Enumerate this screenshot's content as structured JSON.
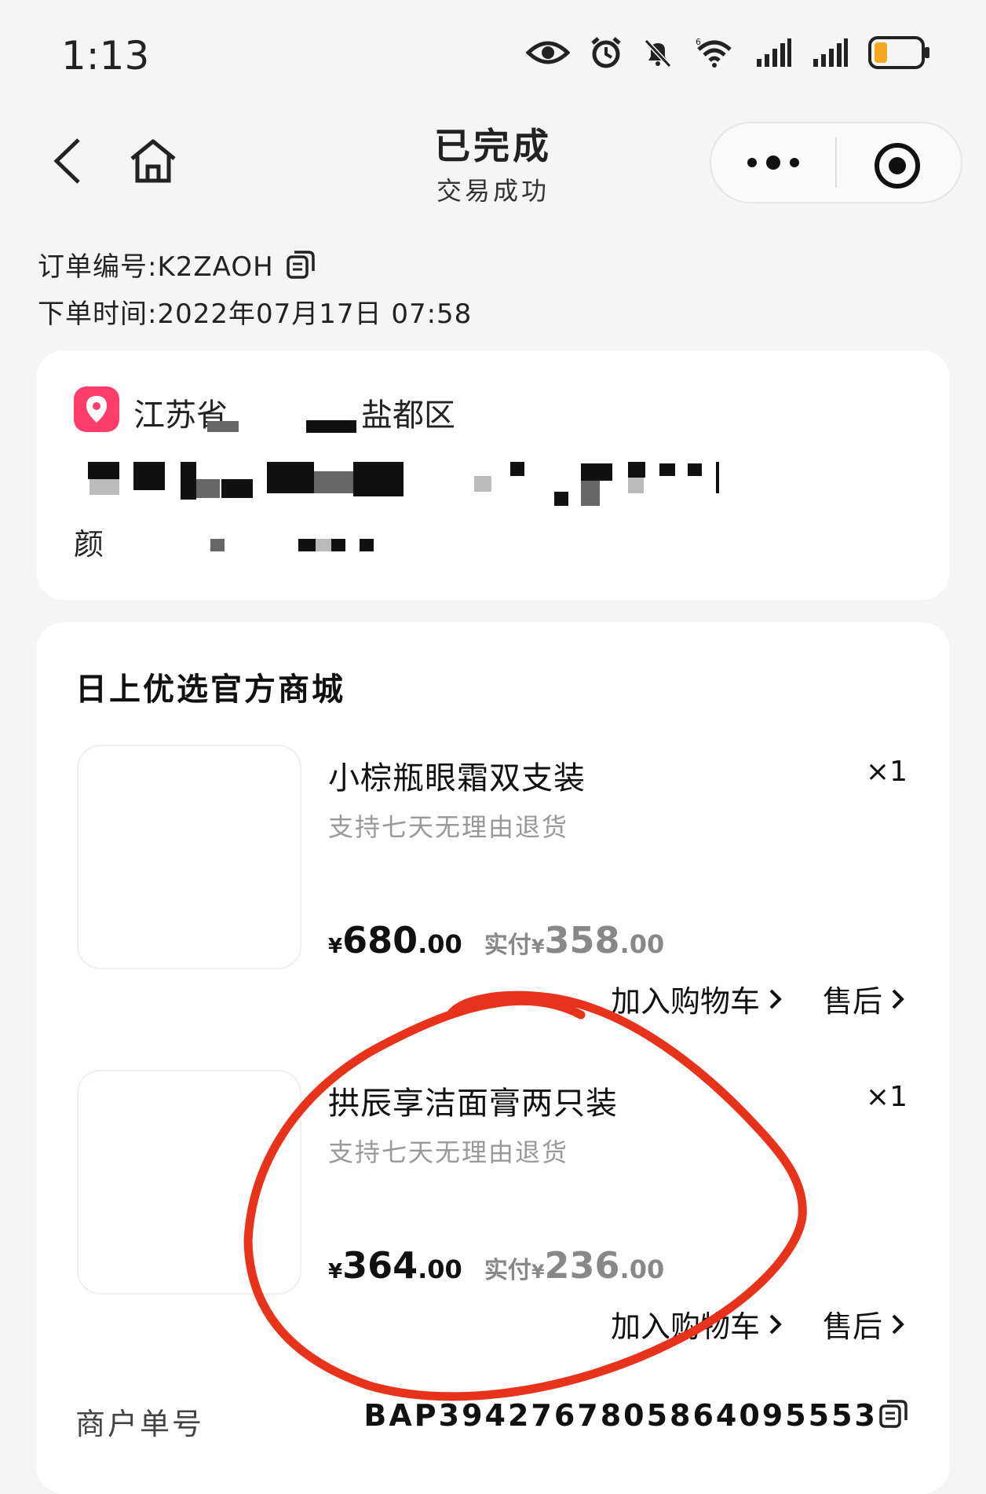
{
  "status_bar": {
    "time": "1:13",
    "wifi_badge": "6"
  },
  "header": {
    "title": "已完成",
    "subtitle": "交易成功"
  },
  "order": {
    "number_line": "订单编号:K2ZAOH",
    "time_line": "下单时间:2022年07月17日 07:58"
  },
  "address": {
    "line1_visible": "江苏省",
    "line1_suffix": "盐都区",
    "recipient_visible": "颜"
  },
  "shop": {
    "name": "日上优选官方商城",
    "products": [
      {
        "name": "小棕瓶眼霜双支装",
        "qty": "×1",
        "tag": "支持七天无理由退货",
        "price_int": "680",
        "price_dec": ".00",
        "paid_label": "实付",
        "paid_int": "358",
        "paid_dec": ".00",
        "cart_label": "加入购物车",
        "aftersale_label": "售后"
      },
      {
        "name": "拱辰享洁面膏两只装",
        "qty": "×1",
        "tag": "支持七天无理由退货",
        "price_int": "364",
        "price_dec": ".00",
        "paid_label": "实付",
        "paid_int": "236",
        "paid_dec": ".00",
        "cart_label": "加入购物车",
        "aftersale_label": "售后"
      }
    ]
  },
  "merchant": {
    "label": "商户单号",
    "value": "BAP3942767805864095553"
  },
  "currency_symbol": "¥",
  "colors": {
    "pin": "#ff3d6b",
    "annotation": "#e8331c",
    "muted": "#888888"
  }
}
